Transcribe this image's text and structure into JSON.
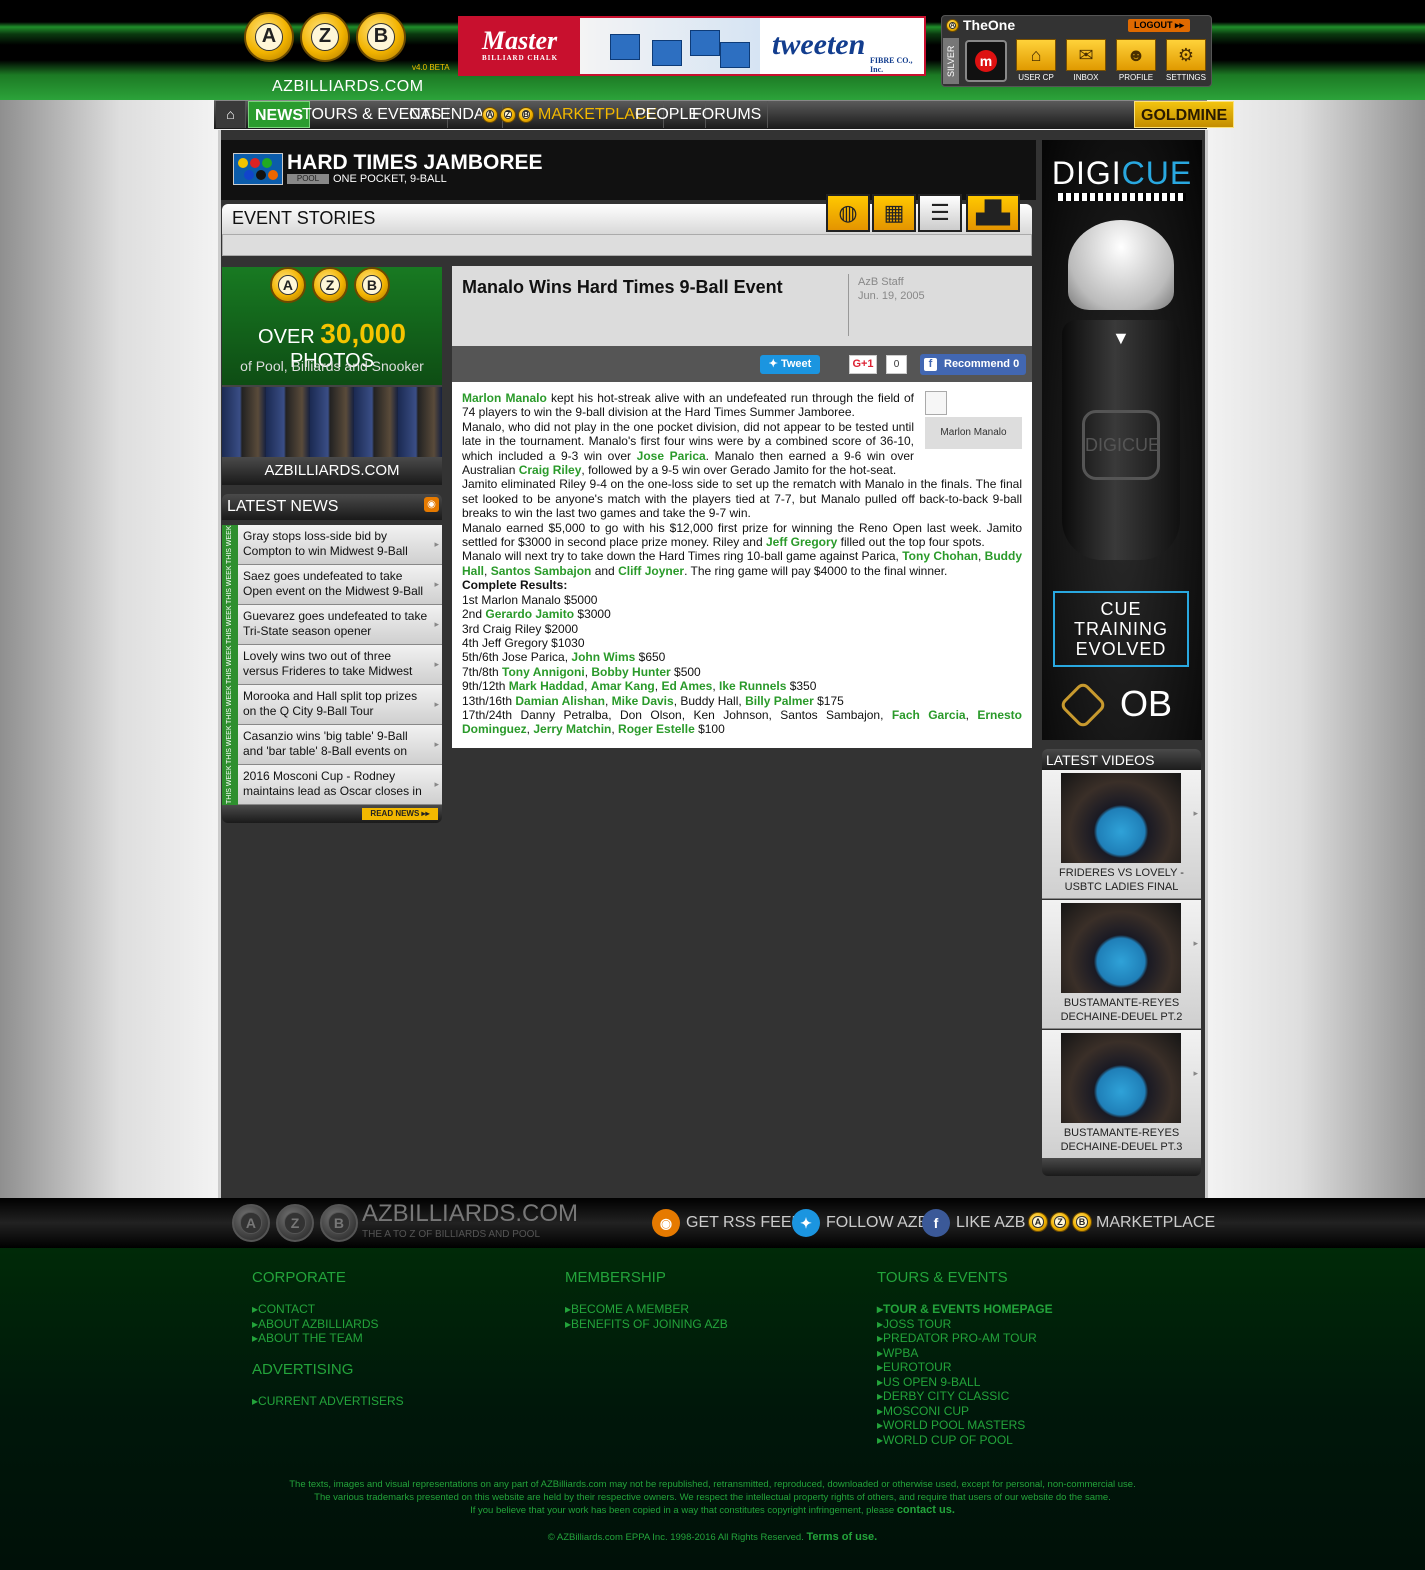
{
  "header": {
    "logo_letters": [
      "A",
      "Z",
      "B"
    ],
    "logo_text": "AZBILLIARDS.COM",
    "version": "v4.0 BETA",
    "banner": {
      "brand_left": "Master",
      "brand_left_sub": "BILLIARD CHALK",
      "brand_right": "tweeten",
      "brand_right_sub": "FIBRE CO., Inc."
    },
    "user": {
      "name": "TheOne",
      "logout": "LOGOUT",
      "level": "SILVER",
      "buttons": [
        {
          "label": "USER CP",
          "icon": "home-icon"
        },
        {
          "label": "INBOX",
          "icon": "envelope-icon"
        },
        {
          "label": "PROFILE",
          "icon": "person-icon"
        },
        {
          "label": "SETTINGS",
          "icon": "gear-icon"
        }
      ]
    }
  },
  "nav": {
    "home_icon": "home-icon",
    "items": [
      "NEWS",
      "TOURS & EVENTS",
      "CALENDAR",
      "MARKETPLACE",
      "PEOPLE",
      "FORUMS"
    ],
    "goldmine": "GOLDMINE"
  },
  "event": {
    "title": "HARD TIMES JAMBOREE",
    "tag": "POOL",
    "subtitle": "ONE POCKET, 9-BALL",
    "section_title": "EVENT STORIES",
    "tab_icons": [
      "globe-icon",
      "calendar-icon",
      "document-icon",
      "podium-icon"
    ]
  },
  "promo": {
    "line1_pre": "OVER",
    "line1_num": "30,000",
    "line1_post": "PHOTOS",
    "line2": "of Pool, Billiards and Snooker",
    "site": "AZBILLIARDS.COM"
  },
  "latest_news": {
    "title": "LATEST NEWS",
    "week_label": "THIS WEEK",
    "items": [
      "Gray stops loss-side bid by Compton to win Midwest 9-Ball",
      "Saez goes undefeated to take Open event on the Midwest 9-Ball",
      "Guevarez goes undefeated to take Tri-State season opener",
      "Lovely wins two out of three versus Frideres to take Midwest",
      "Morooka and Hall split top prizes on the Q City 9-Ball Tour",
      "Casanzio wins 'big table' 9-Ball and 'bar table' 8-Ball events on",
      "2016 Mosconi Cup - Rodney maintains lead as Oscar closes in"
    ],
    "read_more": "READ NEWS"
  },
  "article": {
    "title": "Manalo Wins Hard Times 9-Ball Event",
    "author": "AzB Staff",
    "date": "Jun. 19, 2005",
    "share": {
      "tweet": "Tweet",
      "gplus": "G+1",
      "gplus_count": "0",
      "fb": "Recommend 0"
    },
    "image_caption": "Marlon Manalo",
    "results_heading": "Complete Results:"
  },
  "right_ad": {
    "brand_a": "DIGI",
    "brand_b": "CUE",
    "tagline": [
      "CUE",
      "TRAINING",
      "EVOLVED"
    ],
    "ob": "OB",
    "engrave": "DIGICUE"
  },
  "latest_videos": {
    "title": "LATEST VIDEOS",
    "items": [
      [
        "FRIDERES VS LOVELY -",
        "USBTC LADIES FINAL"
      ],
      [
        "BUSTAMANTE-REYES",
        "DECHAINE-DEUEL PT.2"
      ],
      [
        "BUSTAMANTE-REYES",
        "DECHAINE-DEUEL PT.3"
      ]
    ]
  },
  "footer_bar": {
    "site": "AZBILLIARDS.COM",
    "tagline": "THE A TO Z OF BILLIARDS AND POOL",
    "rss": "GET RSS FEED",
    "twitter": "FOLLOW AZB",
    "facebook": "LIKE AZB",
    "market": "MARKETPLACE"
  },
  "footer": {
    "corporate": {
      "title": "CORPORATE",
      "links": [
        "CONTACT",
        "ABOUT AZBILLIARDS",
        "ABOUT THE TEAM"
      ]
    },
    "advertising": {
      "title": "ADVERTISING",
      "links": [
        "CURRENT ADVERTISERS"
      ]
    },
    "membership": {
      "title": "MEMBERSHIP",
      "links": [
        "BECOME A MEMBER",
        "BENEFITS OF JOINING AZB"
      ]
    },
    "tours": {
      "title": "TOURS & EVENTS",
      "links": [
        "TOUR & EVENTS HOMEPAGE",
        "JOSS TOUR",
        "PREDATOR PRO-AM TOUR",
        "WPBA",
        "EUROTOUR",
        "US OPEN 9-BALL",
        "DERBY CITY CLASSIC",
        "MOSCONI CUP",
        "WORLD POOL MASTERS",
        "WORLD CUP OF POOL"
      ]
    },
    "legal1": "The texts, images and visual representations on any part of AZBilliards.com may not be republished, retransmitted, reproduced, downloaded or otherwise used, except for personal, non-commercial use.",
    "legal2": "The various trademarks presented on this website are held by their respective owners. We respect the intellectual property rights of others, and require that users of our website do the same.",
    "legal3": "If you believe that your work has been copied in a way that constitutes copyright infringement, please",
    "legal3_link": "contact us.",
    "copyright": "© AZBilliards.com EPPA Inc. 1998-2016 All Rights Reserved.",
    "terms": "Terms of use."
  },
  "colors": {
    "accent_green": "#2a9a2a",
    "gold": "#f2b800",
    "dark": "#333333"
  }
}
